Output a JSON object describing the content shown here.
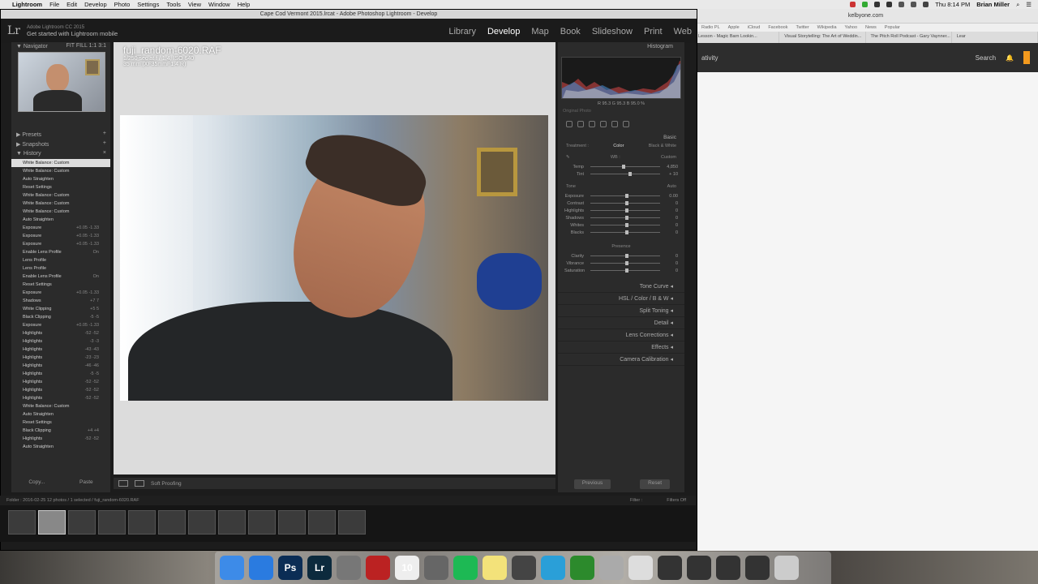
{
  "menubar": {
    "apple": "",
    "app": "Lightroom",
    "items": [
      "File",
      "Edit",
      "Develop",
      "Photo",
      "Settings",
      "Tools",
      "View",
      "Window",
      "Help"
    ],
    "clock": "Thu 8:14 PM",
    "user": "Brian Miller"
  },
  "browser": {
    "url": "kelbyone.com",
    "bookmarks": [
      "Radio PL",
      "Apple",
      "iCloud",
      "Facebook",
      "Twitter",
      "Wikipedia",
      "Yahoo",
      "News",
      "Popular"
    ],
    "tabs": [
      "Lesson - Magic Barn Lookin...",
      "Visual Storytelling: The Art of Weddin...",
      "The Pitch Roll Podcast - Gary Vaynner...",
      "Lear"
    ],
    "nav_left": "ativity",
    "search": "Search"
  },
  "lightroom": {
    "window_title": "Cape Cod Vermont 2015.lrcat - Adobe Photoshop Lightroom - Develop",
    "logo": "Lr",
    "identity_small": "Adobe Lightroom CC 2015",
    "identity_big": "Get started with Lightroom mobile",
    "modules": [
      "Library",
      "Develop",
      "Map",
      "Book",
      "Slideshow",
      "Print",
      "Web"
    ],
    "active_module": "Develop",
    "left": {
      "navigator": "Navigator",
      "nav_zoom": "FIT  FILL  1:1  3:1",
      "presets": "Presets",
      "snapshots": "Snapshots",
      "history": "History",
      "history_rows": [
        {
          "name": "White Balance: Custom",
          "val": ""
        },
        {
          "name": "White Balance: Custom",
          "val": ""
        },
        {
          "name": "Auto Straighten",
          "val": ""
        },
        {
          "name": "Reset Settings",
          "val": ""
        },
        {
          "name": "White Balance: Custom",
          "val": ""
        },
        {
          "name": "White Balance: Custom",
          "val": ""
        },
        {
          "name": "White Balance: Custom",
          "val": ""
        },
        {
          "name": "Auto Straighten",
          "val": ""
        },
        {
          "name": "Exposure",
          "val": "+0.05 -1.33"
        },
        {
          "name": "Exposure",
          "val": "+0.05 -1.33"
        },
        {
          "name": "Exposure",
          "val": "+0.05 -1.33"
        },
        {
          "name": "Enable Lens Profile",
          "val": "On"
        },
        {
          "name": "Lens Profile",
          "val": ""
        },
        {
          "name": "Lens Profile",
          "val": ""
        },
        {
          "name": "Enable Lens Profile",
          "val": "On"
        },
        {
          "name": "Reset Settings",
          "val": ""
        },
        {
          "name": "Exposure",
          "val": "+0.05 -1.33"
        },
        {
          "name": "Shadows",
          "val": "+7 7"
        },
        {
          "name": "White Clipping",
          "val": "+5 5"
        },
        {
          "name": "Black Clipping",
          "val": "-5 -5"
        },
        {
          "name": "Exposure",
          "val": "+0.05 -1.33"
        },
        {
          "name": "Highlights",
          "val": "-52 -52"
        },
        {
          "name": "Highlights",
          "val": "-3 -3"
        },
        {
          "name": "Highlights",
          "val": "-43 -43"
        },
        {
          "name": "Highlights",
          "val": "-23 -23"
        },
        {
          "name": "Highlights",
          "val": "-46 -46"
        },
        {
          "name": "Highlights",
          "val": "-5 -5"
        },
        {
          "name": "Highlights",
          "val": "-52 -52"
        },
        {
          "name": "Highlights",
          "val": "-52 -52"
        },
        {
          "name": "Highlights",
          "val": "-52 -52"
        },
        {
          "name": "White Balance: Custom",
          "val": ""
        },
        {
          "name": "Auto Straighten",
          "val": ""
        },
        {
          "name": "Reset Settings",
          "val": ""
        },
        {
          "name": "Black Clipping",
          "val": "+4 +4"
        },
        {
          "name": "Highlights",
          "val": "-52 -52"
        },
        {
          "name": "Auto Straighten",
          "val": ""
        }
      ],
      "copy": "Copy...",
      "paste": "Paste"
    },
    "photo": {
      "filename": "fuji_random-6020.RAF",
      "exposure_line": "1/250 sec at f / 1.4, ISO 640",
      "lens_line": "35 mm (XF35mmF1.4 R)"
    },
    "toolbar": {
      "soft_proofing": "Soft Proofing"
    },
    "right": {
      "histogram": "Histogram",
      "histo_vals": "R 95.3  G 95.3  B 95.0 %",
      "original": "Original Photo",
      "basic": "Basic",
      "treatment": "Treatment :",
      "color": "Color",
      "bw": "Black & White",
      "wb_label": "WB :",
      "wb_value": "Custom",
      "temp_label": "Temp",
      "temp_val": "4,850",
      "tint_label": "Tint",
      "tint_val": "+ 10",
      "tone": "Tone",
      "auto": "Auto",
      "sliders": [
        {
          "label": "Exposure",
          "val": "0.00",
          "pos": 0.5
        },
        {
          "label": "Contrast",
          "val": "0",
          "pos": 0.5
        },
        {
          "label": "Highlights",
          "val": "0",
          "pos": 0.5
        },
        {
          "label": "Shadows",
          "val": "0",
          "pos": 0.5
        },
        {
          "label": "Whites",
          "val": "0",
          "pos": 0.5
        },
        {
          "label": "Blacks",
          "val": "0",
          "pos": 0.5
        }
      ],
      "presence": "Presence",
      "presence_sliders": [
        {
          "label": "Clarity",
          "val": "0",
          "pos": 0.5
        },
        {
          "label": "Vibrance",
          "val": "0",
          "pos": 0.5
        },
        {
          "label": "Saturation",
          "val": "0",
          "pos": 0.5
        }
      ],
      "sections": [
        "Tone Curve",
        "HSL / Color / B & W",
        "Split Toning",
        "Detail",
        "Lens Corrections",
        "Effects",
        "Camera Calibration"
      ],
      "previous": "Previous",
      "reset": "Reset"
    },
    "filmstrip": {
      "path": "Folder : 2016-02-25   12 photos / 1 selected / fuji_random-6020.RAF",
      "filter": "Filter :",
      "filters_off": "Filters Off",
      "thumb_count": 12,
      "selected_index": 1
    }
  },
  "dock": {
    "apps": [
      "Finder",
      "Safari",
      "Ps",
      "Lr",
      "Launchpad",
      "Photo Booth",
      "10",
      "System Preferences",
      "Spotify",
      "Notes",
      "Aperture",
      "Skype",
      "Camtasia",
      "Preview",
      "Doc",
      "Screen",
      "Screen",
      "Screen",
      "Screen",
      "Trash"
    ]
  }
}
